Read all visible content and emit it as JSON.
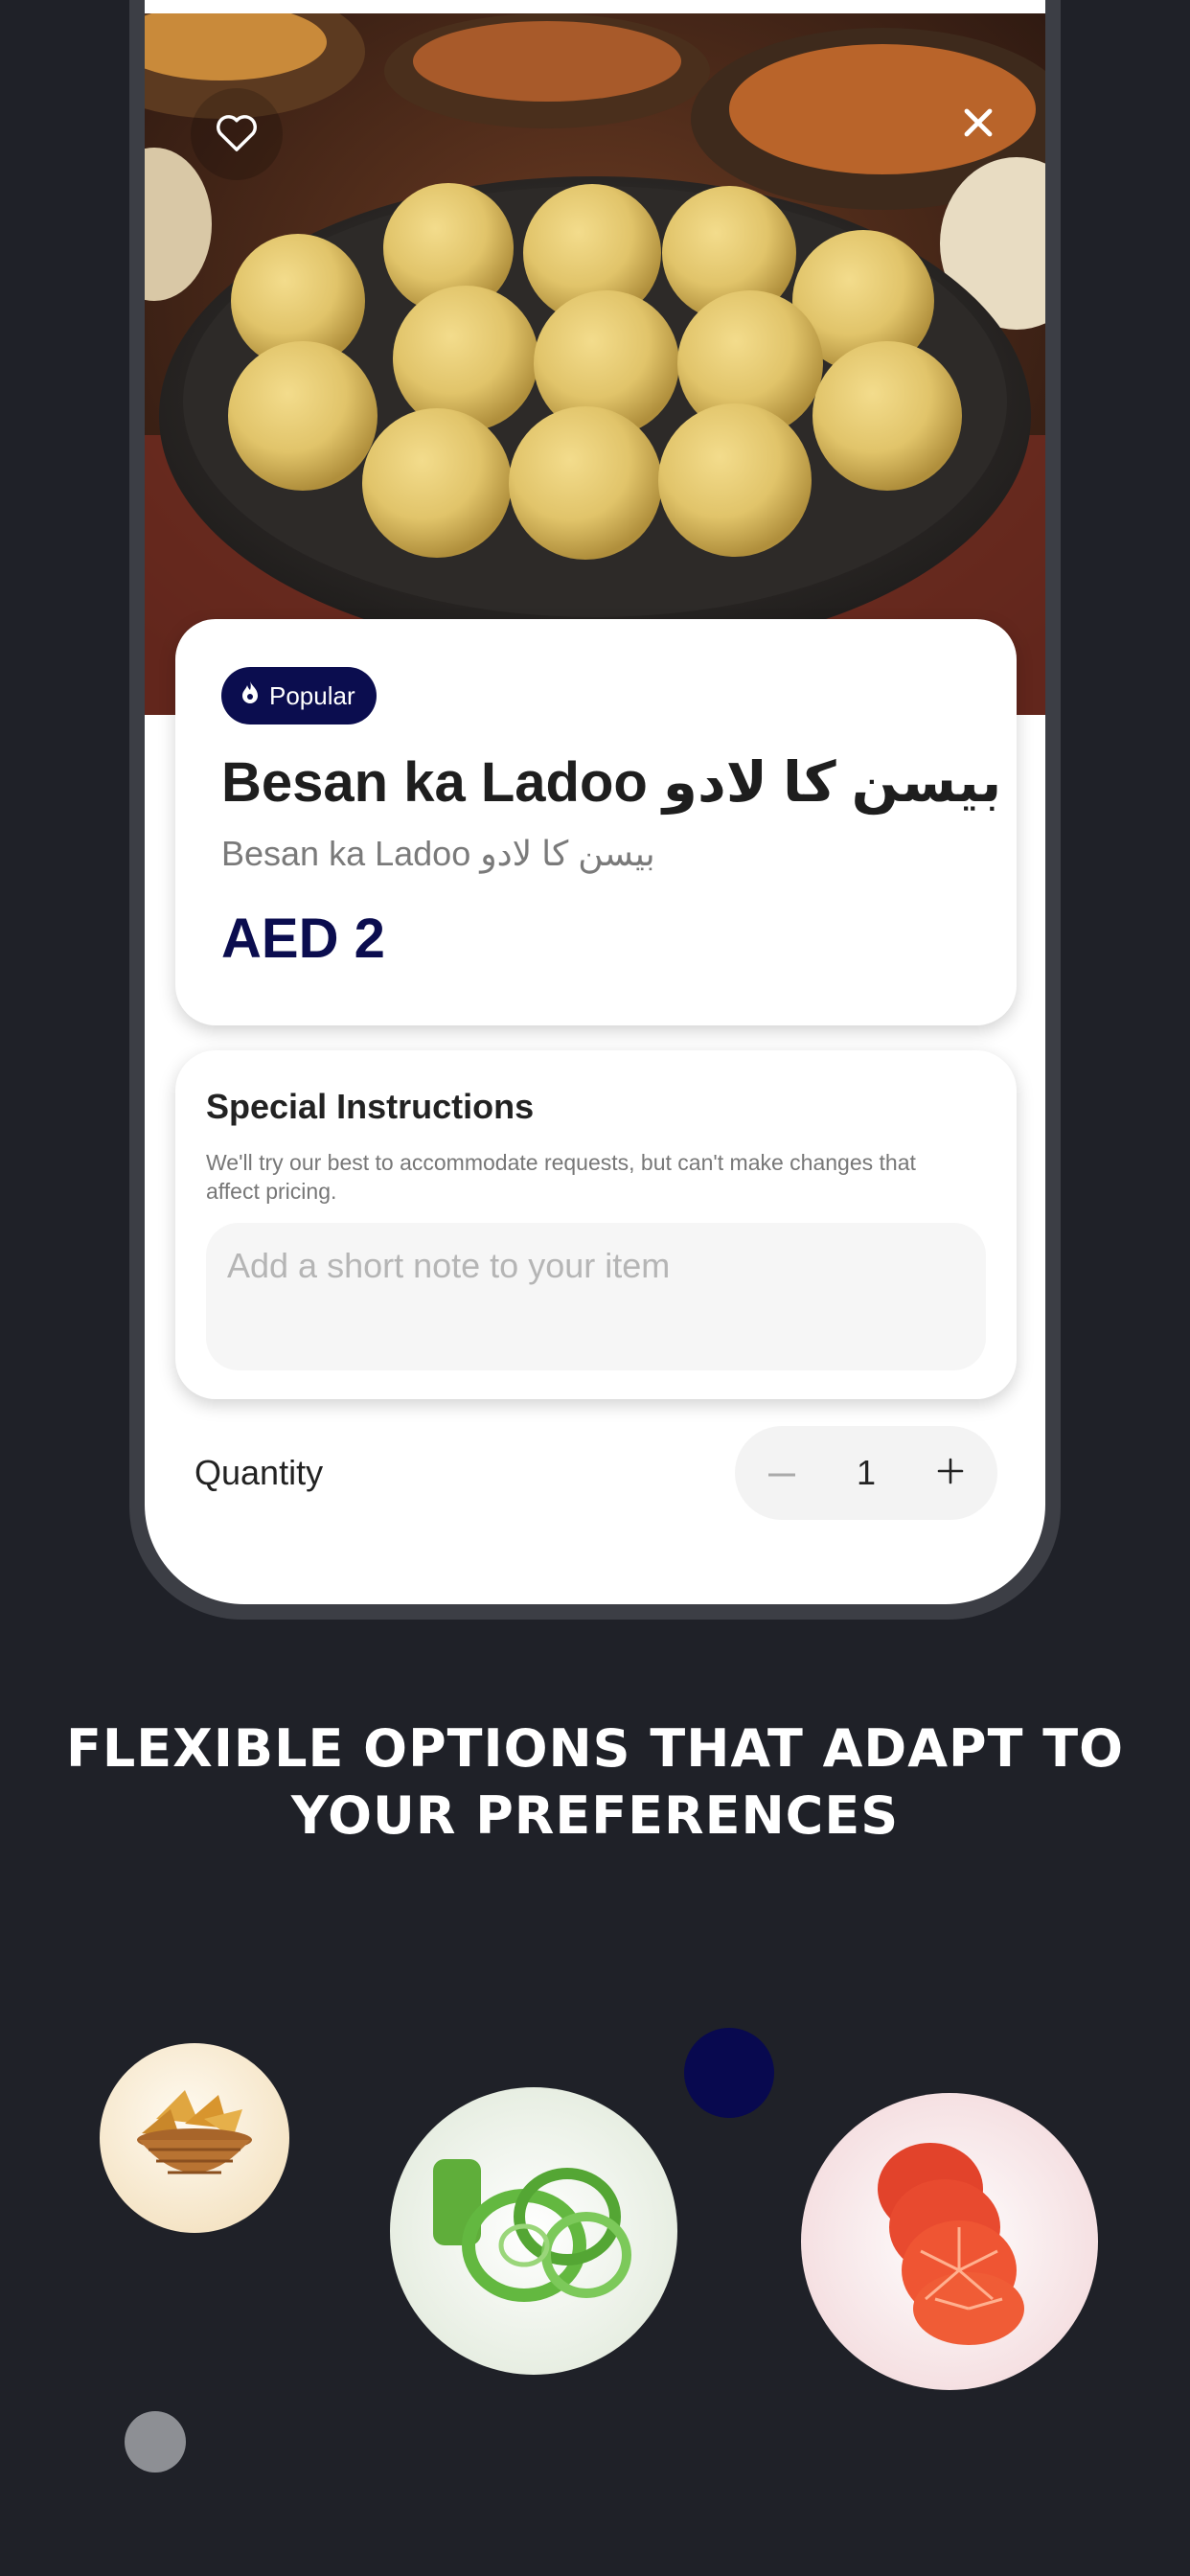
{
  "item": {
    "badge": "Popular",
    "title": "Besan ka Ladoo بیسن کا لادو",
    "subtitle": "Besan ka Ladoo بیسن کا لادو",
    "price": "AED 2"
  },
  "instructions": {
    "title": "Special Instructions",
    "description": "We'll try our best to accommodate requests, but can't make changes that affect pricing.",
    "placeholder": "Add a short note to your item"
  },
  "quantity": {
    "label": "Quantity",
    "value": "1"
  },
  "caption": {
    "line1": "FLEXIBLE OPTIONS THAT ADAPT TO",
    "line2": "YOUR PREFERENCES"
  },
  "icons": {
    "favorite": "heart-icon",
    "close": "close-icon",
    "badge": "flame-icon",
    "decrement": "minus-icon",
    "increment": "plus-icon"
  },
  "colors": {
    "background": "#1f2128",
    "accent": "#0b0d4f",
    "card": "#ffffff"
  }
}
